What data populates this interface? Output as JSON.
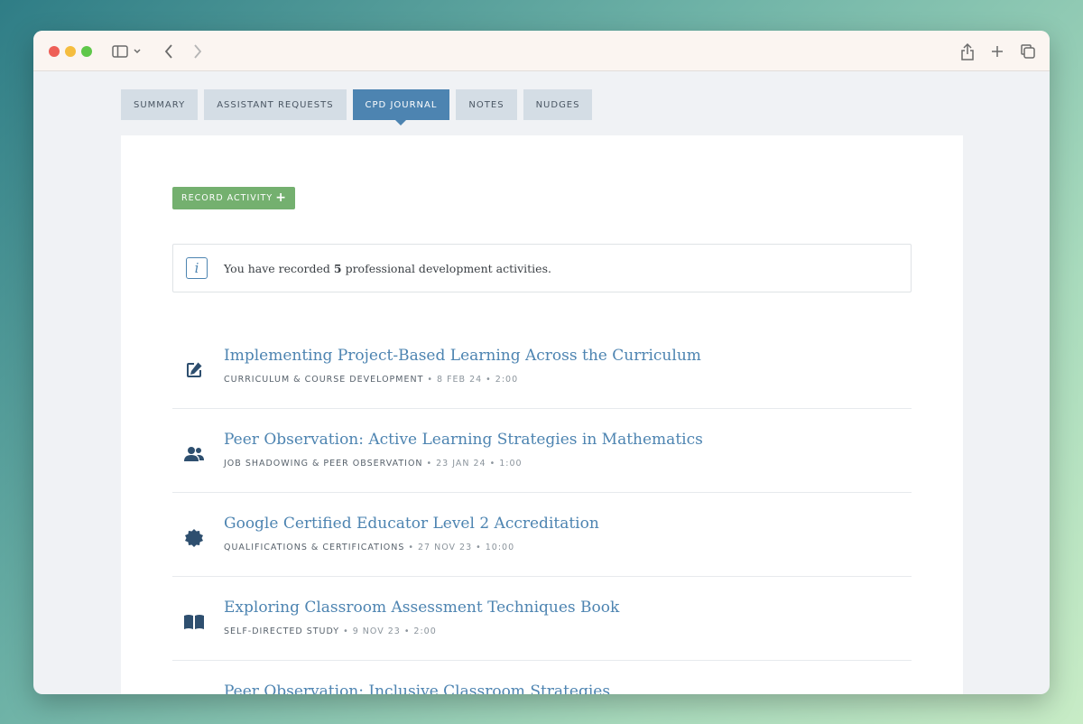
{
  "tabs": [
    {
      "label": "SUMMARY",
      "active": false
    },
    {
      "label": "ASSISTANT REQUESTS",
      "active": false
    },
    {
      "label": "CPD JOURNAL",
      "active": true
    },
    {
      "label": "NOTES",
      "active": false
    },
    {
      "label": "NUDGES",
      "active": false
    }
  ],
  "record_button": {
    "label": "RECORD ACTIVITY",
    "icon": "plus-icon"
  },
  "info": {
    "prefix": "You have recorded ",
    "count": "5",
    "suffix": " professional development activities.",
    "icon": "info-icon"
  },
  "activities": [
    {
      "title": "Implementing Project-Based Learning Across the Curriculum",
      "category": "CURRICULUM & COURSE DEVELOPMENT",
      "date": "8 FEB 24",
      "duration": "2:00",
      "icon": "edit-icon"
    },
    {
      "title": "Peer Observation: Active Learning Strategies in Mathematics",
      "category": "JOB SHADOWING & PEER OBSERVATION",
      "date": "23 JAN 24",
      "duration": "1:00",
      "icon": "users-icon"
    },
    {
      "title": "Google Certified Educator Level 2 Accreditation",
      "category": "QUALIFICATIONS & CERTIFICATIONS",
      "date": "27 NOV 23",
      "duration": "10:00",
      "icon": "certificate-icon"
    },
    {
      "title": "Exploring Classroom Assessment Techniques Book",
      "category": "SELF-DIRECTED STUDY",
      "date": "9 NOV 23",
      "duration": "2:00",
      "icon": "book-icon"
    },
    {
      "title": "Peer Observation: Inclusive Classroom Strategies",
      "category": "",
      "date": "",
      "duration": "",
      "icon": "users-icon"
    }
  ],
  "colors": {
    "accent": "#4d84b1",
    "button": "#74b06f",
    "tab": "#d4dde5"
  }
}
